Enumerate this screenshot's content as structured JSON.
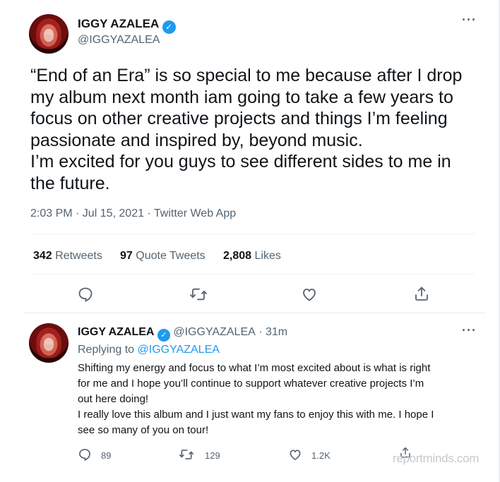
{
  "main_tweet": {
    "author_name": "IGGY AZALEA",
    "author_handle": "@IGGYAZALEA",
    "more_icon": "more-horizontal",
    "text": "“End of an Era” is so special to me because after I drop\nmy album next month iam going to take a few years to\nfocus on other creative projects and things I’m feeling\npassionate and inspired by, beyond music.\nI’m excited for you guys to see different sides to me in\nthe future.",
    "timestamp": "2:03 PM · Jul 15, 2021 · Twitter Web App",
    "stats": {
      "retweets_count": "342",
      "retweets_label": "Retweets",
      "quotes_count": "97",
      "quotes_label": "Quote Tweets",
      "likes_count": "2,808",
      "likes_label": "Likes"
    },
    "actions": [
      "reply",
      "retweet",
      "like",
      "share"
    ]
  },
  "reply_tweet": {
    "author_name": "IGGY AZALEA",
    "author_handle": "@IGGYAZALEA",
    "time": "· 31m",
    "replying_to_label": "Replying to",
    "replying_to_handle": "@IGGYAZALEA",
    "text": "Shifting my energy and focus to what I’m most excited about is what is right\nfor me and I hope you’ll continue to support whatever creative projects I’m\nout here doing!\nI really love this album and I just want my fans to enjoy this with me. I hope I\nsee so many of you on tour!",
    "reply_count": "89",
    "retweet_count": "129",
    "like_count": "1.2K"
  },
  "watermark": "reportminds.com",
  "colors": {
    "accent": "#1d9bf0",
    "text": "#0f1419",
    "secondary": "#536471",
    "divider": "#eff3f4"
  }
}
